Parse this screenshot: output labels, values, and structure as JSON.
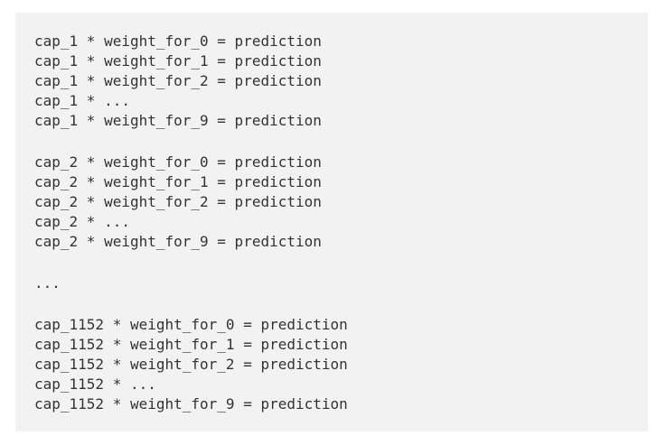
{
  "code_block": {
    "groups": [
      {
        "lines": [
          "cap_1 * weight_for_0 = prediction",
          "cap_1 * weight_for_1 = prediction",
          "cap_1 * weight_for_2 = prediction",
          "cap_1 * ...",
          "cap_1 * weight_for_9 = prediction"
        ]
      },
      {
        "lines": [
          "cap_2 * weight_for_0 = prediction",
          "cap_2 * weight_for_1 = prediction",
          "cap_2 * weight_for_2 = prediction",
          "cap_2 * ...",
          "cap_2 * weight_for_9 = prediction"
        ]
      },
      {
        "lines": [
          "..."
        ]
      },
      {
        "lines": [
          "cap_1152 * weight_for_0 = prediction",
          "cap_1152 * weight_for_1 = prediction",
          "cap_1152 * weight_for_2 = prediction",
          "cap_1152 * ...",
          "cap_1152 * weight_for_9 = prediction"
        ]
      }
    ]
  }
}
